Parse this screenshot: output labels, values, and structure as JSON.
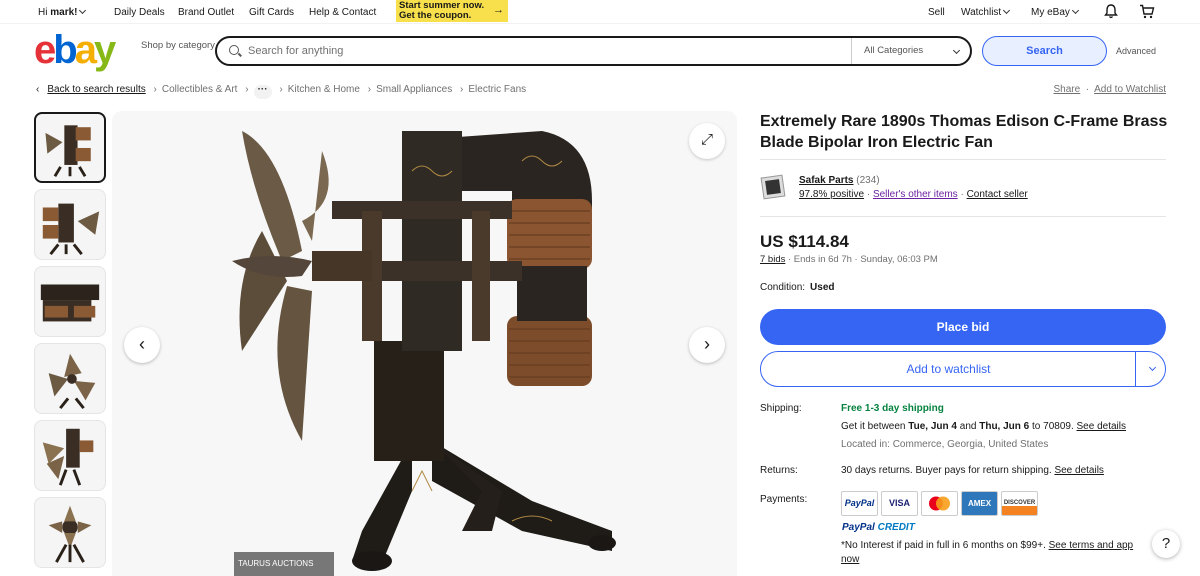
{
  "topbar": {
    "greeting_prefix": "Hi",
    "user": "mark!",
    "links": [
      "Daily Deals",
      "Brand Outlet",
      "Gift Cards",
      "Help & Contact"
    ],
    "promo_line1": "Start summer now.",
    "promo_line2": "Get the coupon.",
    "sell": "Sell",
    "watchlist": "Watchlist",
    "myebay": "My eBay"
  },
  "header": {
    "logo": [
      "e",
      "b",
      "a",
      "y"
    ],
    "shop_by_category": "Shop by category",
    "search_placeholder": "Search for anything",
    "category_select": "All Categories",
    "search_button": "Search",
    "advanced": "Advanced"
  },
  "breadcrumb": {
    "back": "Back to search results",
    "items": [
      "Collectibles & Art",
      "Kitchen & Home",
      "Small Appliances",
      "Electric Fans"
    ],
    "more": "···",
    "share": "Share",
    "add_watchlist": "Add to Watchlist"
  },
  "gallery": {
    "watermark": "TAURUS AUCTIONS"
  },
  "listing": {
    "title": "Extremely Rare 1890s Thomas Edison C-Frame Brass Blade Bipolar Iron Electric Fan",
    "seller_name": "Safak Parts",
    "seller_count": "(234)",
    "seller_positive": "97.8% positive",
    "seller_items": "Seller's other items",
    "contact": "Contact seller",
    "price": "US $114.84",
    "bids": "7 bids",
    "ends": "· Ends in 6d 7h · Sunday, 06:03 PM",
    "condition_label": "Condition:",
    "condition_value": "Used",
    "place_bid": "Place bid",
    "add_watchlist": "Add to watchlist",
    "shipping_label": "Shipping:",
    "shipping_free": "Free 1-3 day shipping",
    "delivery_prefix": "Get it between",
    "delivery_start": "Tue, Jun 4",
    "delivery_and": "and",
    "delivery_end": "Thu, Jun 6",
    "delivery_to": "to 70809.",
    "see_details": "See details",
    "located": "Located in: Commerce, Georgia, United States",
    "returns_label": "Returns:",
    "returns_text": "30 days returns. Buyer pays for return shipping.",
    "returns_details": "See details",
    "payments_label": "Payments:",
    "cards": [
      "PayPal",
      "VISA",
      "",
      "AMEX",
      "DISCOVER"
    ],
    "paypal_credit_a": "PayPal",
    "paypal_credit_b": "CREDIT",
    "financing": "*No Interest if paid in full in 6 months on $99+.",
    "financing_link1": "See terms and app",
    "financing_link2": "now"
  },
  "help": "?"
}
